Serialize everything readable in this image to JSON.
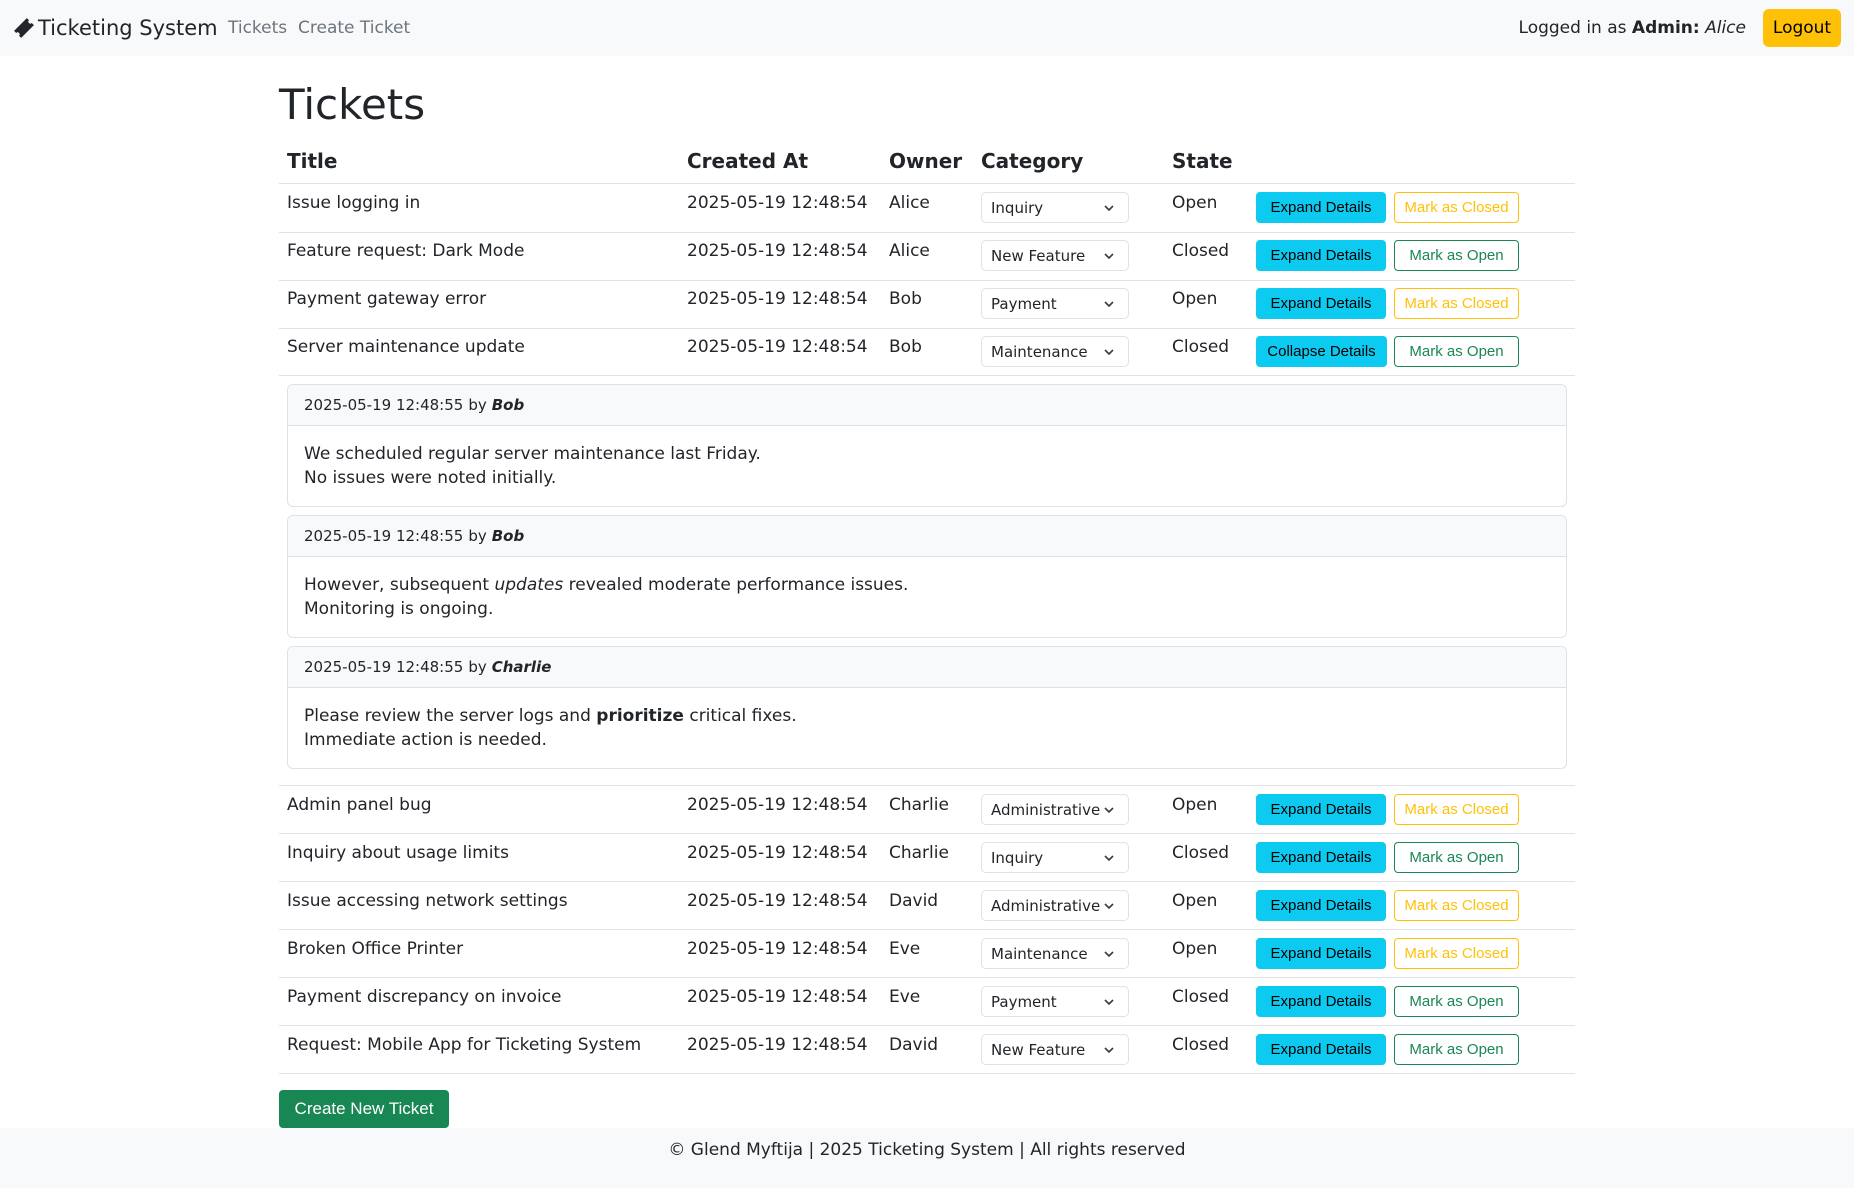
{
  "navbar": {
    "brand": "Ticketing System",
    "links": [
      "Tickets",
      "Create Ticket"
    ],
    "logged_prefix": "Logged in as",
    "role": "Admin:",
    "user": "Alice",
    "logout": "Logout"
  },
  "page": {
    "title": "Tickets"
  },
  "table": {
    "headers": [
      "Title",
      "Created At",
      "Owner",
      "Category",
      "State"
    ],
    "rows": [
      {
        "title": "Issue logging in",
        "created": "2025-05-19 12:48:54",
        "owner": "Alice",
        "category": "Inquiry",
        "state": "Open",
        "details_btn": "Expand Details",
        "toggle_btn": "Mark as Closed"
      },
      {
        "title": "Feature request: Dark Mode",
        "created": "2025-05-19 12:48:54",
        "owner": "Alice",
        "category": "New Feature",
        "state": "Closed",
        "details_btn": "Expand Details",
        "toggle_btn": "Mark as Open"
      },
      {
        "title": "Payment gateway error",
        "created": "2025-05-19 12:48:54",
        "owner": "Bob",
        "category": "Payment",
        "state": "Open",
        "details_btn": "Expand Details",
        "toggle_btn": "Mark as Closed"
      },
      {
        "title": "Server maintenance update",
        "created": "2025-05-19 12:48:54",
        "owner": "Bob",
        "category": "Maintenance",
        "state": "Closed",
        "details_btn": "Collapse Details",
        "toggle_btn": "Mark as Open"
      },
      {
        "title": "Admin panel bug",
        "created": "2025-05-19 12:48:54",
        "owner": "Charlie",
        "category": "Administrative",
        "state": "Open",
        "details_btn": "Expand Details",
        "toggle_btn": "Mark as Closed"
      },
      {
        "title": "Inquiry about usage limits",
        "created": "2025-05-19 12:48:54",
        "owner": "Charlie",
        "category": "Inquiry",
        "state": "Closed",
        "details_btn": "Expand Details",
        "toggle_btn": "Mark as Open"
      },
      {
        "title": "Issue accessing network settings",
        "created": "2025-05-19 12:48:54",
        "owner": "David",
        "category": "Administrative",
        "state": "Open",
        "details_btn": "Expand Details",
        "toggle_btn": "Mark as Closed"
      },
      {
        "title": "Broken Office Printer",
        "created": "2025-05-19 12:48:54",
        "owner": "Eve",
        "category": "Maintenance",
        "state": "Open",
        "details_btn": "Expand Details",
        "toggle_btn": "Mark as Closed"
      },
      {
        "title": "Payment discrepancy on invoice",
        "created": "2025-05-19 12:48:54",
        "owner": "Eve",
        "category": "Payment",
        "state": "Closed",
        "details_btn": "Expand Details",
        "toggle_btn": "Mark as Open"
      },
      {
        "title": "Request: Mobile App for Ticketing System",
        "created": "2025-05-19 12:48:54",
        "owner": "David",
        "category": "New Feature",
        "state": "Closed",
        "details_btn": "Expand Details",
        "toggle_btn": "Mark as Open"
      }
    ]
  },
  "comments": [
    {
      "timestamp": "2025-05-19 12:48:55",
      "by": "by",
      "author": "Bob",
      "line1": "We scheduled regular server maintenance last Friday.",
      "line2": "No issues were noted initially."
    },
    {
      "timestamp": "2025-05-19 12:48:55",
      "by": "by",
      "author": "Bob",
      "line1_a": "However, subsequent ",
      "line1_em": "updates",
      "line1_b": " revealed moderate performance issues.",
      "line2": "Monitoring is ongoing."
    },
    {
      "timestamp": "2025-05-19 12:48:55",
      "by": "by",
      "author": "Charlie",
      "line1_a": "Please review the server logs and ",
      "line1_strong": "prioritize",
      "line1_b": " critical fixes.",
      "line2": "Immediate action is needed."
    }
  ],
  "create_button": "Create New Ticket",
  "footer": "© Glend Myftija | 2025 Ticketing System | All rights reserved",
  "colors": {
    "info": "#0dcaf0",
    "warning": "#ffc107",
    "success": "#198754",
    "navbar_bg": "#f8f9fa"
  },
  "icons": {
    "brand": "ticket-icon",
    "select": "chevron-down-icon"
  }
}
